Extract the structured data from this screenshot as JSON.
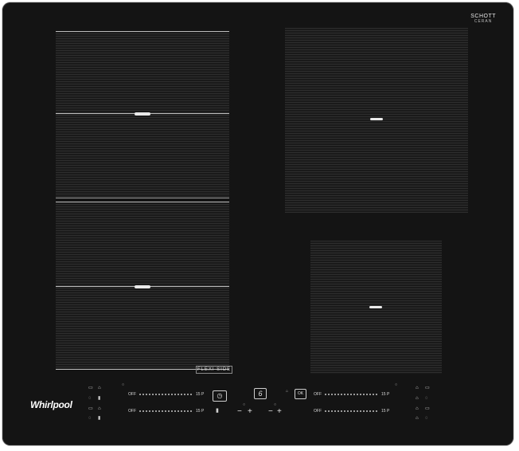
{
  "brand": {
    "maker": "Whirlpool",
    "glass_top": "SCHOTT",
    "glass_bottom": "CERAN"
  },
  "flexi_label": "FLEXI SIDE",
  "controls": {
    "left_top": {
      "off": "OFF",
      "max": "15 P"
    },
    "left_bottom": {
      "off": "OFF",
      "max": "15 P"
    },
    "right_top": {
      "off": "OFF",
      "max": "15 P"
    },
    "right_bottom": {
      "off": "OFF",
      "max": "15 P"
    },
    "timer_icon": "clock-icon",
    "six_sense_label": "6",
    "lock_label": "OK",
    "minus": "−",
    "plus": "+"
  },
  "colors": {
    "glass": "#141414",
    "zone_lines": "#bdbdbd"
  }
}
